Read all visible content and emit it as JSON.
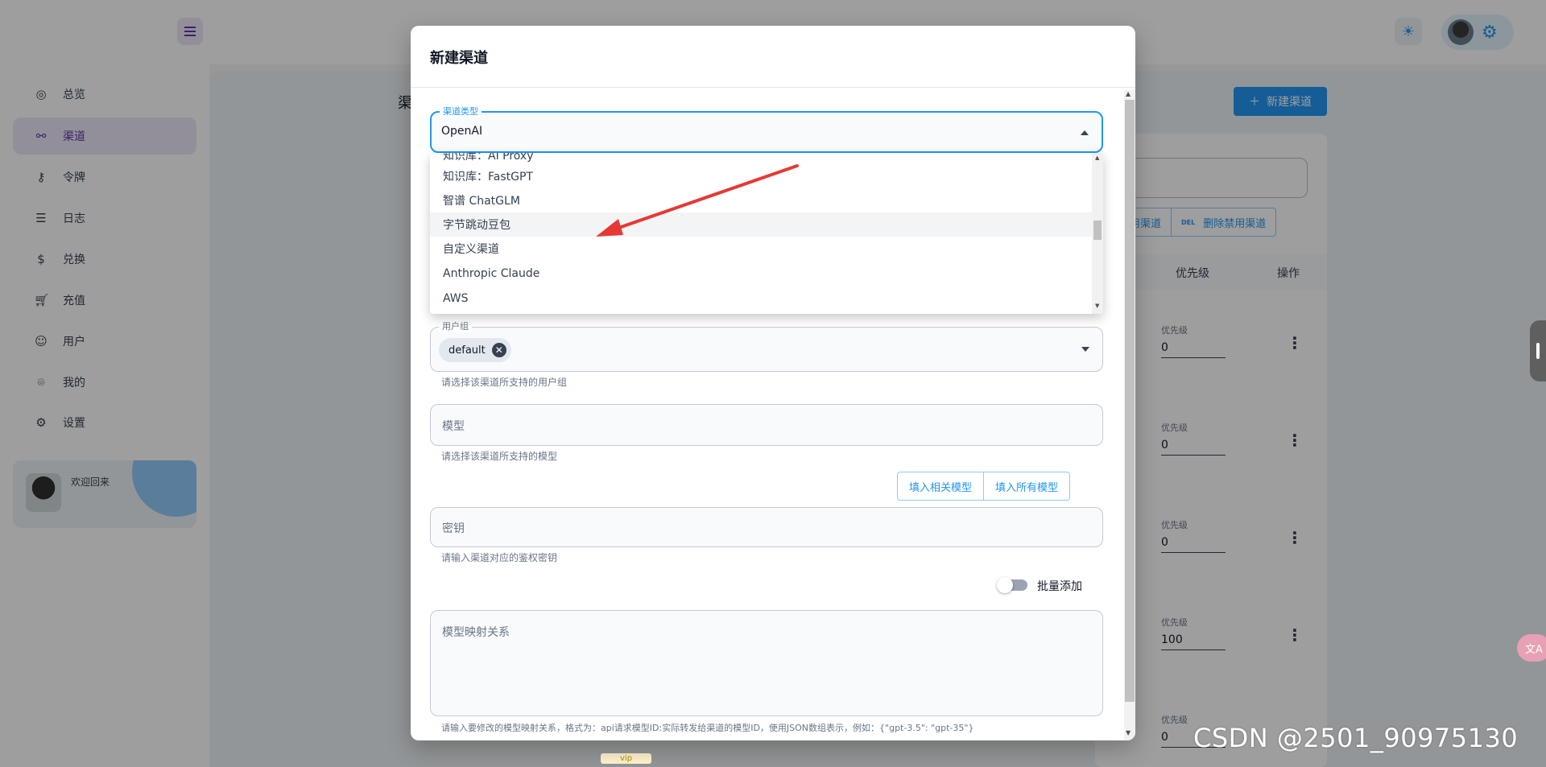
{
  "sidebar": {
    "items": [
      {
        "label": "总览",
        "icon": "dashboard-icon"
      },
      {
        "label": "渠道",
        "icon": "channel-icon"
      },
      {
        "label": "令牌",
        "icon": "key-icon"
      },
      {
        "label": "日志",
        "icon": "log-icon"
      },
      {
        "label": "兑换",
        "icon": "dollar-icon"
      },
      {
        "label": "充值",
        "icon": "cart-icon"
      },
      {
        "label": "用户",
        "icon": "user-icon"
      },
      {
        "label": "我的",
        "icon": "profile-icon"
      },
      {
        "label": "设置",
        "icon": "settings-icon"
      }
    ],
    "welcome": "欢迎回来"
  },
  "page": {
    "title": "渠",
    "new_channel_button": "新建渠道",
    "bulk_buttons": [
      "用渠道",
      "删除禁用渠道"
    ],
    "bulk_del_tag": "DEL",
    "table_headers": {
      "priority": "优先级",
      "actions": "操作"
    },
    "rows": [
      {
        "label": "优先级",
        "value": "0"
      },
      {
        "label": "优先级",
        "value": "0"
      },
      {
        "label": "优先级",
        "value": "0"
      },
      {
        "label": "优先级",
        "value": "100"
      },
      {
        "label": "优先级",
        "value": "0"
      }
    ],
    "vip": "vip"
  },
  "modal": {
    "title": "新建渠道",
    "channel_type": {
      "label": "渠道类型",
      "value": "OpenAI"
    },
    "dropdown_options": [
      "知识库：AI Proxy",
      "知识库：FastGPT",
      "智谱 ChatGLM",
      "字节跳动豆包",
      "自定义渠道",
      "Anthropic Claude",
      "AWS"
    ],
    "highlighted_option_index": 3,
    "user_group": {
      "label": "用户组",
      "chip": "default",
      "helper": "请选择该渠道所支持的用户组"
    },
    "model": {
      "placeholder": "模型",
      "helper": "请选择该渠道所支持的模型"
    },
    "fill_buttons": {
      "related": "填入相关模型",
      "all": "填入所有模型"
    },
    "key": {
      "placeholder": "密钥",
      "helper": "请输入渠道对应的鉴权密钥"
    },
    "batch_toggle": {
      "label": "批量添加",
      "on": false
    },
    "mapping": {
      "placeholder": "模型映射关系",
      "helper": "请输入要修改的模型映射关系，格式为：api请求模型ID:实际转发给渠道的模型ID，使用JSON数组表示，例如：{\"gpt-3.5\": \"gpt-35\"}"
    }
  },
  "watermark": "CSDN @2501_90975130",
  "colors": {
    "accent": "#2196f3",
    "primary": "#5e35b1",
    "annotation_arrow": "#e53935"
  }
}
